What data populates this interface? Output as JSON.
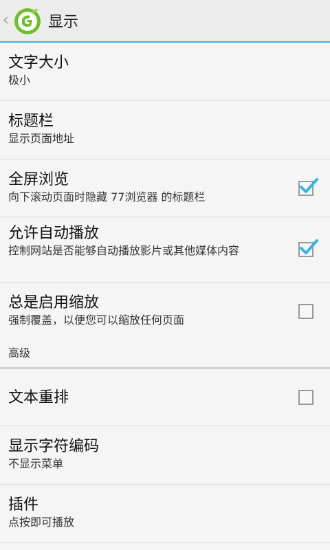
{
  "header": {
    "title": "显示"
  },
  "prefs": [
    {
      "title": "文字大小",
      "summary": "极小"
    },
    {
      "title": "标题栏",
      "summary": "显示页面地址"
    },
    {
      "title": "全屏浏览",
      "summary": "向下滚动页面时隐藏 77浏览器 的标题栏",
      "checked": true
    },
    {
      "title": "允许自动播放",
      "summary": "控制网站是否能够自动播放影片或其他媒体内容",
      "checked": true
    },
    {
      "title": "总是启用缩放",
      "summary": "强制覆盖，以便您可以缩放任何页面",
      "checked": false
    }
  ],
  "section": {
    "label": "高级"
  },
  "advanced": [
    {
      "title": "文本重排",
      "checked": false
    },
    {
      "title": "显示字符编码",
      "summary": "不显示菜单"
    },
    {
      "title": "插件",
      "summary": "点按即可播放"
    }
  ],
  "colors": {
    "accent": "#33b5e5",
    "check": "#33b5e5",
    "logo_green": "#6cbf2a"
  },
  "icons": {
    "back": "chevron-left-icon",
    "logo": "app-logo-icon",
    "checkbox": "checkbox-icon"
  }
}
